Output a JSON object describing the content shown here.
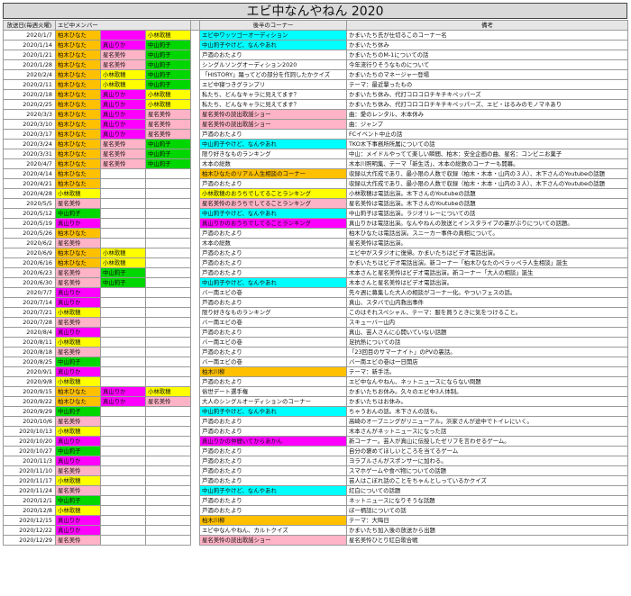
{
  "title": "エビ中なんやねん 2020",
  "headers": {
    "date": "放送日(毎週火曜)",
    "members": "エビ中メンバー",
    "corner": "後半のコーナー",
    "note": "備考"
  },
  "colors": {
    "or": "#ffc000",
    "ma": "#ff00ff",
    "pk": "#ffb3c6",
    "gr": "#00d600",
    "cy": "#00ffff",
    "ye": "#ffff00"
  },
  "rows": [
    {
      "date": "2020/1/7",
      "m": [
        [
          "柏木ひなた",
          "or"
        ],
        [
          "",
          "ma"
        ],
        [
          "小林歌穂",
          "ye"
        ]
      ],
      "c": [
        "エビ中ワッツゴーオーディション",
        "cy"
      ],
      "n": "かまいたち氏が仕切るこのコーナー名"
    },
    {
      "date": "2020/1/14",
      "m": [
        [
          "柏木ひなた",
          "or"
        ],
        [
          "真山りか",
          "ma"
        ],
        [
          "中山莉子",
          "gr"
        ]
      ],
      "c": [
        "中山莉子やけど、なんやあれ",
        "cy"
      ],
      "n": "かまいたち休み"
    },
    {
      "date": "2020/1/21",
      "m": [
        [
          "柏木ひなた",
          "or"
        ],
        [
          "星名美怜",
          "pk"
        ],
        [
          "中山莉子",
          "gr"
        ]
      ],
      "c": [
        "芦酒のおたより",
        ""
      ],
      "n": "かまいたちのM-1についての話"
    },
    {
      "date": "2020/1/28",
      "m": [
        [
          "柏木ひなた",
          "or"
        ],
        [
          "星名美怜",
          "pk"
        ],
        [
          "中山莉子",
          "gr"
        ]
      ],
      "c": [
        "シングルソングオーディション2020",
        ""
      ],
      "n": "今年流行りそうなものについて"
    },
    {
      "date": "2020/2/4",
      "m": [
        [
          "柏木ひなた",
          "or"
        ],
        [
          "小林歌穂",
          "ye"
        ],
        [
          "中山莉子",
          "gr"
        ]
      ],
      "c": [
        "「HISTORY」踊ってどの部分を作詞したかクイズ",
        ""
      ],
      "n": "かまいたちのマネージャー登場"
    },
    {
      "date": "2020/2/11",
      "m": [
        [
          "柏木ひなた",
          "or"
        ],
        [
          "小林歌穂",
          "ye"
        ],
        [
          "中山莉子",
          "gr"
        ]
      ],
      "c": [
        "エビ中寝つきグランプリ",
        ""
      ],
      "n": "テーマ：最近撃ったもの"
    },
    {
      "date": "2020/2/18",
      "m": [
        [
          "柏木ひなた",
          "or"
        ],
        [
          "真山りか",
          "ma"
        ],
        [
          "小林歌穂",
          "ye"
        ]
      ],
      "c": [
        "私たち、どんなキャラに見えてます？",
        ""
      ],
      "n": "かまいたち休み、代打コロコロチキチキペッパーズ"
    },
    {
      "date": "2020/2/25",
      "m": [
        [
          "柏木ひなた",
          "or"
        ],
        [
          "真山りか",
          "ma"
        ],
        [
          "小林歌穂",
          "ye"
        ]
      ],
      "c": [
        "私たち、どんなキャラに見えてます？",
        ""
      ],
      "n": "かまいたち休み、代打コロコロチキチキペッパーズ、エビ・はるみのモノマネあり"
    },
    {
      "date": "2020/3/3",
      "m": [
        [
          "柏木ひなた",
          "or"
        ],
        [
          "真山りか",
          "ma"
        ],
        [
          "星名美怜",
          "pk"
        ]
      ],
      "c": [
        "星名美怜の読出歌謡ショー",
        "pk"
      ],
      "n": "曲：愛のレンタル、木本休み"
    },
    {
      "date": "2020/3/10",
      "m": [
        [
          "柏木ひなた",
          "or"
        ],
        [
          "真山りか",
          "ma"
        ],
        [
          "星名美怜",
          "pk"
        ]
      ],
      "c": [
        "星名美怜の読出歌謡ショー",
        "pk"
      ],
      "n": "曲：ジャンプ"
    },
    {
      "date": "2020/3/17",
      "m": [
        [
          "柏木ひなた",
          "or"
        ],
        [
          "真山りか",
          "ma"
        ],
        [
          "星名美怜",
          "pk"
        ]
      ],
      "c": [
        "芦酒のおたより",
        ""
      ],
      "n": "FCイベント中止の話"
    },
    {
      "date": "2020/3/24",
      "m": [
        [
          "柏木ひなた",
          "or"
        ],
        [
          "星名美怜",
          "pk"
        ],
        [
          "中山莉子",
          "gr"
        ]
      ],
      "c": [
        "中山莉子やけど、なんやあれ",
        "cy"
      ],
      "n": "TKO木下事務所所属についての話"
    },
    {
      "date": "2020/3/31",
      "m": [
        [
          "柏木ひなた",
          "or"
        ],
        [
          "星名美怜",
          "pk"
        ],
        [
          "中山莉子",
          "gr"
        ]
      ],
      "c": [
        "限り好きなものランキング",
        ""
      ],
      "n": "中山：メイドルやってて楽しい瞬間、柏木：安全企画の曲、星名：コンビニお菓子"
    },
    {
      "date": "2020/4/7",
      "m": [
        [
          "柏木ひなた",
          "or"
        ],
        [
          "星名美怜",
          "pk"
        ],
        [
          "中山莉子",
          "gr"
        ]
      ],
      "c": [
        "木本の総数",
        ""
      ],
      "n": "木本川照明集、テーマ「新生活」、木本の総数のコーナーも開幕。"
    },
    {
      "date": "2020/4/14",
      "m": [
        [
          "柏木ひなた",
          "or"
        ],
        [
          "",
          ""
        ],
        [
          "",
          ""
        ]
      ],
      "c": [
        "柏木ひなたのリアル人生相談のコーナー",
        "or"
      ],
      "n": "収録以大作成であり、最小限の人数で収録（柏木・木本・山内の３人）、木下さんのYoutubeの話題"
    },
    {
      "date": "2020/4/21",
      "m": [
        [
          "柏木ひなた",
          "or"
        ],
        [
          "",
          ""
        ],
        [
          "",
          ""
        ]
      ],
      "c": [
        "芦酒のおたより",
        ""
      ],
      "n": "収録以大作成であり、最小限の人数で収録（柏木・木本・山内の３人）、木下さんのYoutubeの話題"
    },
    {
      "date": "2020/4/28",
      "m": [
        [
          "小林歌穂",
          "ye"
        ],
        [
          "",
          ""
        ],
        [
          "",
          ""
        ]
      ],
      "c": [
        "小林歌穂のおうちでしてることランキング",
        "ye"
      ],
      "n": "小林歌穂は電話出演。木下さんのYoutubeの話題"
    },
    {
      "date": "2020/5/5",
      "m": [
        [
          "星名美怜",
          "pk"
        ],
        [
          "",
          ""
        ],
        [
          "",
          ""
        ]
      ],
      "c": [
        "星名美怜のおうちでしてることランキング",
        "pk"
      ],
      "n": "星名美怜は電話出演。木下さんのYoutubeの話題"
    },
    {
      "date": "2020/5/12",
      "m": [
        [
          "中山莉子",
          "gr"
        ],
        [
          "",
          ""
        ],
        [
          "",
          ""
        ]
      ],
      "c": [
        "中山莉子やけど、なんやあれ",
        "cy"
      ],
      "n": "中山莉子は電話出演。ラジオリレーについての話"
    },
    {
      "date": "2020/5/19",
      "m": [
        [
          "真山りか",
          "ma"
        ],
        [
          "",
          ""
        ],
        [
          "",
          ""
        ]
      ],
      "c": [
        "真山りかのおうちでしてることランキング",
        "ma"
      ],
      "n": "真山りかは電話出演。なんやねんの放送とインスタライブの裏がぶりについての話題。"
    },
    {
      "date": "2020/5/26",
      "m": [
        [
          "柏木ひなた",
          "or"
        ],
        [
          "",
          ""
        ],
        [
          "",
          ""
        ]
      ],
      "c": [
        "芦酒のおたより",
        ""
      ],
      "n": "柏木ひなたは電話出演。スニーカー事件の真相について。"
    },
    {
      "date": "2020/6/2",
      "m": [
        [
          "星名美怜",
          "pk"
        ],
        [
          "",
          ""
        ],
        [
          "",
          ""
        ]
      ],
      "c": [
        "木本の総数",
        ""
      ],
      "n": "星名美怜は電話出演。"
    },
    {
      "date": "2020/6/9",
      "m": [
        [
          "柏木ひなた",
          "or"
        ],
        [
          "小林歌穂",
          "ye"
        ],
        [
          "",
          ""
        ]
      ],
      "c": [
        "芦酒のおたより",
        ""
      ],
      "n": "エビ中がスタジオに復帰。かまいたちはビデオ電話出演。"
    },
    {
      "date": "2020/6/16",
      "m": [
        [
          "柏木ひなた",
          "or"
        ],
        [
          "小林歌穂",
          "ye"
        ],
        [
          "",
          ""
        ]
      ],
      "c": [
        "芦酒のおたより",
        ""
      ],
      "n": "かまいたちはビデオ電話出演。新コーナー「柏木ひなたのペラッペラ人生相談」誕生"
    },
    {
      "date": "2020/6/23",
      "m": [
        [
          "星名美怜",
          "pk"
        ],
        [
          "中山莉子",
          "gr"
        ],
        [
          "",
          ""
        ]
      ],
      "c": [
        "芦酒のおたより",
        ""
      ],
      "n": "木本さんと星名美怜はビデオ電話出演。新コーナー「大人の相談」誕生"
    },
    {
      "date": "2020/6/30",
      "m": [
        [
          "星名美怜",
          "pk"
        ],
        [
          "中山莉子",
          "gr"
        ],
        [
          "",
          ""
        ]
      ],
      "c": [
        "中山莉子やけど、なんやあれ",
        "cy"
      ],
      "n": "木本さんと星名美怜はビデオ電話出演。"
    },
    {
      "date": "2020/7/7",
      "m": [
        [
          "真山りか",
          "ma"
        ],
        [
          "",
          ""
        ],
        [
          "",
          ""
        ]
      ],
      "c": [
        "バー南エビの巻",
        ""
      ],
      "n": "先々週に募集した大人の相談がコーナー化。やついフェスの話。"
    },
    {
      "date": "2020/7/14",
      "m": [
        [
          "真山りか",
          "ma"
        ],
        [
          "",
          ""
        ],
        [
          "",
          ""
        ]
      ],
      "c": [
        "芦酒のおたより",
        ""
      ],
      "n": "真山、スタバで山内救出事件"
    },
    {
      "date": "2020/7/21",
      "m": [
        [
          "小林歌穂",
          "ye"
        ],
        [
          "",
          ""
        ],
        [
          "",
          ""
        ]
      ],
      "c": [
        "限り好きなものランキング",
        ""
      ],
      "n": "このはそれスペシャル、テーマ：服を買うときに気をつけること。"
    },
    {
      "date": "2020/7/28",
      "m": [
        [
          "星名美怜",
          "pk"
        ],
        [
          "",
          ""
        ],
        [
          "",
          ""
        ]
      ],
      "c": [
        "バー南エビの巻",
        ""
      ],
      "n": "スキューバー山内"
    },
    {
      "date": "2020/8/4",
      "m": [
        [
          "真山りか",
          "ma"
        ],
        [
          "",
          ""
        ],
        [
          "",
          ""
        ]
      ],
      "c": [
        "芦酒のおたより",
        ""
      ],
      "n": "真山、芸人さんに心開いていない話題"
    },
    {
      "date": "2020/8/11",
      "m": [
        [
          "小林歌穂",
          "ye"
        ],
        [
          "",
          ""
        ],
        [
          "",
          ""
        ]
      ],
      "c": [
        "バー南エビの巻",
        ""
      ],
      "n": "足抗熱についての話"
    },
    {
      "date": "2020/8/18",
      "m": [
        [
          "星名美怜",
          "pk"
        ],
        [
          "",
          ""
        ],
        [
          "",
          ""
        ]
      ],
      "c": [
        "芦酒のおたより",
        ""
      ],
      "n": "「23回目のサマーナイト」のPVの裏話。"
    },
    {
      "date": "2020/8/25",
      "m": [
        [
          "中山莉子",
          "gr"
        ],
        [
          "",
          ""
        ],
        [
          "",
          ""
        ]
      ],
      "c": [
        "バー南エビの巻",
        ""
      ],
      "n": "バー南エビの巻は一日開店"
    },
    {
      "date": "2020/9/1",
      "m": [
        [
          "真山りか",
          "ma"
        ],
        [
          "",
          ""
        ],
        [
          "",
          ""
        ]
      ],
      "c": [
        "柏木川柳",
        "or"
      ],
      "n": "テーマ：新手活。"
    },
    {
      "date": "2020/9/8",
      "m": [
        [
          "小林歌穂",
          "ye"
        ],
        [
          "",
          ""
        ],
        [
          "",
          ""
        ]
      ],
      "c": [
        "芦酒のおたより",
        ""
      ],
      "n": "エビ中なんやねん、ネットニュースにならない問題"
    },
    {
      "date": "2020/9/15",
      "m": [
        [
          "柏木ひなた",
          "or"
        ],
        [
          "真山りか",
          "ma"
        ],
        [
          "小林歌穂",
          "ye"
        ]
      ],
      "c": [
        "俗世デート選手権",
        ""
      ],
      "n": "かまいたちお休み。久々のエビ中3人体制。"
    },
    {
      "date": "2020/9/22",
      "m": [
        [
          "柏木ひなた",
          "or"
        ],
        [
          "真山りか",
          "ma"
        ],
        [
          "星名美怜",
          "pk"
        ]
      ],
      "c": [
        "大人のシングルオーディションのコーナー",
        ""
      ],
      "n": "かまいたちはお休み。"
    },
    {
      "date": "2020/9/29",
      "m": [
        [
          "中山莉子",
          "gr"
        ],
        [
          "",
          ""
        ],
        [
          "",
          ""
        ]
      ],
      "c": [
        "中山莉子やけど、なんやあれ",
        "cy"
      ],
      "n": "ちゃうおんの話。木下さんの話も。"
    },
    {
      "date": "2020/10/6",
      "m": [
        [
          "星名美怜",
          "pk"
        ],
        [
          "",
          ""
        ],
        [
          "",
          ""
        ]
      ],
      "c": [
        "芦酒のおたより",
        ""
      ],
      "n": "高崎のオープニングがリニューアル。浜家さんが途中でトイレにいく。"
    },
    {
      "date": "2020/10/13",
      "m": [
        [
          "小林歌穂",
          "ye"
        ],
        [
          "",
          ""
        ],
        [
          "",
          ""
        ]
      ],
      "c": [
        "芦酒のおたより",
        ""
      ],
      "n": "木本さんがネットニュースになった話"
    },
    {
      "date": "2020/10/20",
      "m": [
        [
          "真山りか",
          "ma"
        ],
        [
          "",
          ""
        ],
        [
          "",
          ""
        ]
      ],
      "c": [
        "真山りかの仲間いてからあかん",
        "ma"
      ],
      "n": "新コーナー。芸人が真山に伝授したゼリフを言わせるゲーム。"
    },
    {
      "date": "2020/10/27",
      "m": [
        [
          "中山莉子",
          "gr"
        ],
        [
          "",
          ""
        ],
        [
          "",
          ""
        ]
      ],
      "c": [
        "芦酒のおたより",
        ""
      ],
      "n": "自分の褒めてほしいところを当てるゲーム"
    },
    {
      "date": "2020/11/3",
      "m": [
        [
          "真山りか",
          "ma"
        ],
        [
          "",
          ""
        ],
        [
          "",
          ""
        ]
      ],
      "c": [
        "芦酒のおたより",
        ""
      ],
      "n": "ヨラブルさんがスポンサーに加わる。"
    },
    {
      "date": "2020/11/10",
      "m": [
        [
          "星名美怜",
          "pk"
        ],
        [
          "",
          ""
        ],
        [
          "",
          ""
        ]
      ],
      "c": [
        "芦酒のおたより",
        ""
      ],
      "n": "スマホゲームや食べ物についての話題"
    },
    {
      "date": "2020/11/17",
      "m": [
        [
          "小林歌穂",
          "ye"
        ],
        [
          "",
          ""
        ],
        [
          "",
          ""
        ]
      ],
      "c": [
        "芦酒のおたより",
        ""
      ],
      "n": "芸人はこぼれ話のことをちゃんとしっているかクイズ"
    },
    {
      "date": "2020/11/24",
      "m": [
        [
          "星名美怜",
          "pk"
        ],
        [
          "",
          ""
        ],
        [
          "",
          ""
        ]
      ],
      "c": [
        "中山莉子やけど、なんやあれ",
        "cy"
      ],
      "n": "紅白についての話題"
    },
    {
      "date": "2020/12/1",
      "m": [
        [
          "中山莉子",
          "gr"
        ],
        [
          "",
          ""
        ],
        [
          "",
          ""
        ]
      ],
      "c": [
        "芦酒のおたより",
        ""
      ],
      "n": "ネットニュースになりそうな話題"
    },
    {
      "date": "2020/12/8",
      "m": [
        [
          "小林歌穂",
          "ye"
        ],
        [
          "",
          ""
        ],
        [
          "",
          ""
        ]
      ],
      "c": [
        "芦酒のおたより",
        ""
      ],
      "n": "ぼー柄話についての話"
    },
    {
      "date": "2020/12/15",
      "m": [
        [
          "真山りか",
          "ma"
        ],
        [
          "",
          ""
        ],
        [
          "",
          ""
        ]
      ],
      "c": [
        "柏木川柳",
        "or"
      ],
      "n": "テーマ：大晦日"
    },
    {
      "date": "2020/12/22",
      "m": [
        [
          "真山りか",
          "ma"
        ],
        [
          "",
          ""
        ],
        [
          "",
          ""
        ]
      ],
      "c": [
        "エビ中なんやねん、カルトクイズ",
        ""
      ],
      "n": "かまいたち加入後の放送から出題"
    },
    {
      "date": "2020/12/29",
      "m": [
        [
          "星名美怜",
          "pk"
        ],
        [
          "",
          ""
        ],
        [
          "",
          ""
        ]
      ],
      "c": [
        "星名美怜の読出歌謡ショー",
        "pk"
      ],
      "n": "星名美怜ひとり紅白歌合戦"
    }
  ]
}
